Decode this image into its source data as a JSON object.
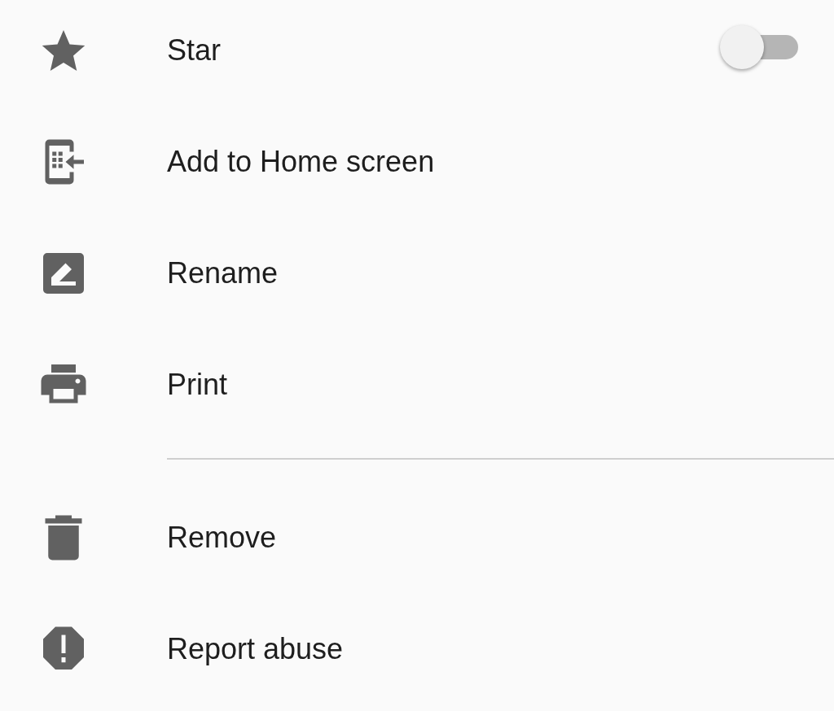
{
  "menu": {
    "groups": [
      [
        {
          "label": "Star",
          "kind": "toggle",
          "on": false
        },
        {
          "label": "Add to Home screen",
          "kind": "action"
        },
        {
          "label": "Rename",
          "kind": "action"
        },
        {
          "label": "Print",
          "kind": "action"
        }
      ],
      [
        {
          "label": "Remove",
          "kind": "action"
        },
        {
          "label": "Report abuse",
          "kind": "action"
        }
      ]
    ]
  }
}
